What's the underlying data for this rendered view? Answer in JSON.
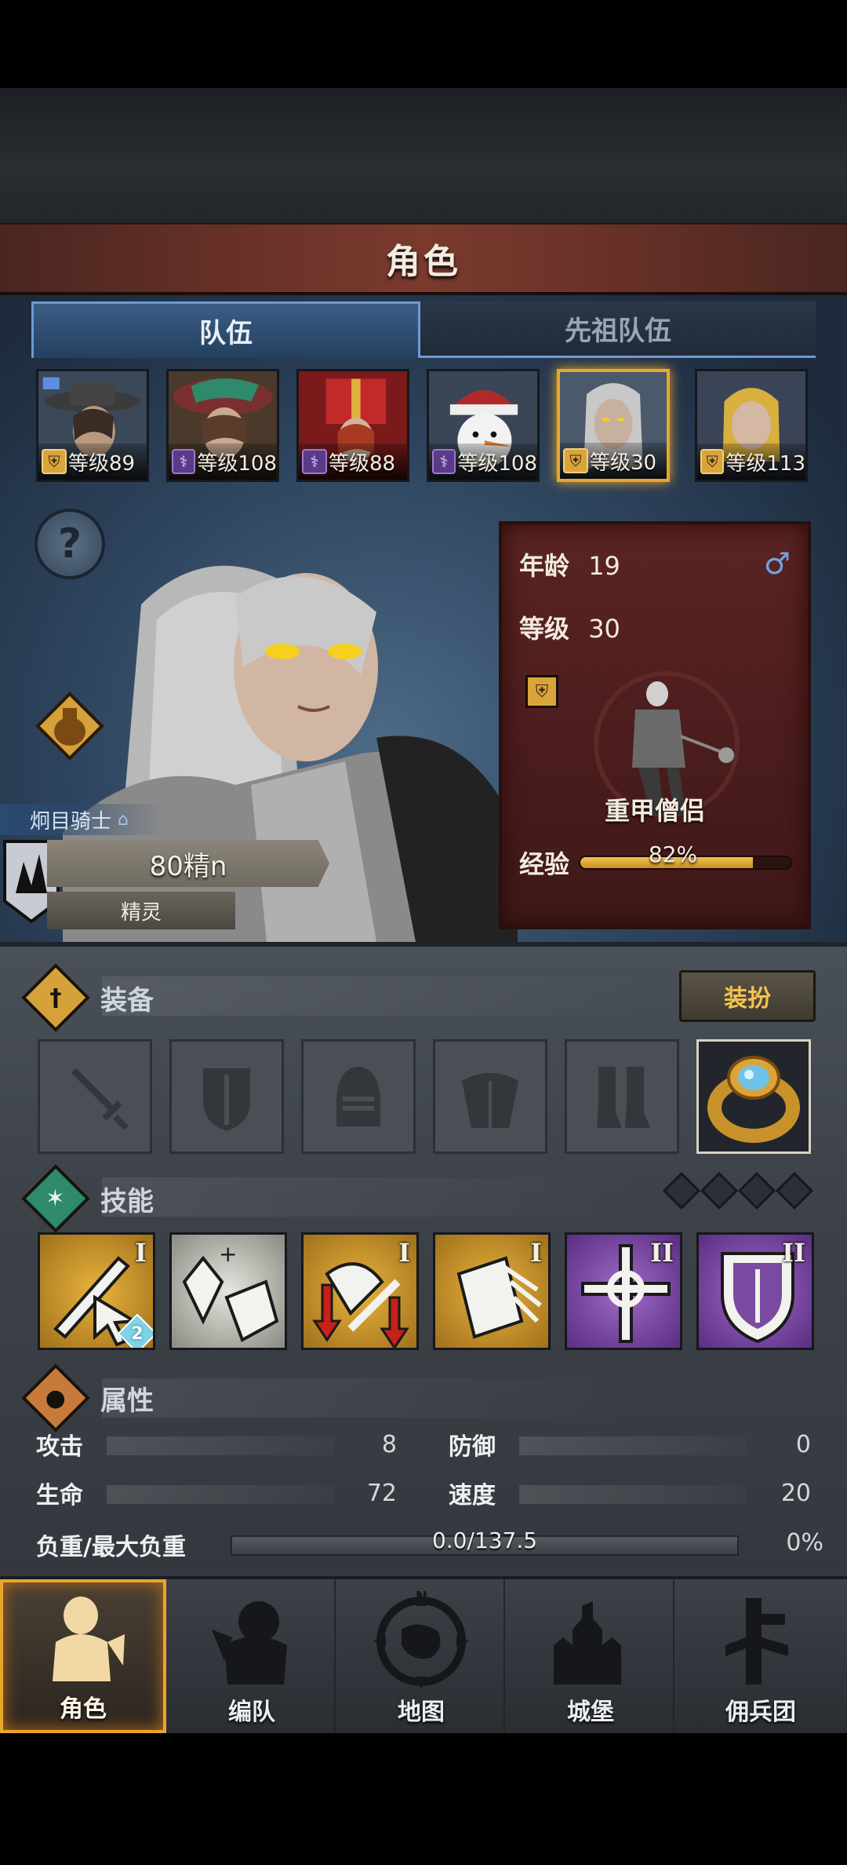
{
  "header": {
    "title": "角色"
  },
  "tabs": [
    {
      "label": "队伍",
      "active": true
    },
    {
      "label": "先祖队伍",
      "active": false
    }
  ],
  "roster": [
    {
      "level_text": "等级89",
      "badge": "shield-badge",
      "badge_color": "#d9a53a",
      "selected": false
    },
    {
      "level_text": "等级108",
      "badge": "staff-badge",
      "badge_color": "#5b3a8a",
      "selected": false
    },
    {
      "level_text": "等级88",
      "badge": "staff-badge",
      "badge_color": "#5b3a8a",
      "selected": false
    },
    {
      "level_text": "等级108",
      "badge": "staff-badge",
      "badge_color": "#5b3a8a",
      "selected": false
    },
    {
      "level_text": "等级30",
      "badge": "shield-badge",
      "badge_color": "#d9a53a",
      "selected": true
    },
    {
      "level_text": "等级113",
      "badge": "shield-badge",
      "badge_color": "#d9a53a",
      "selected": false
    }
  ],
  "hero": {
    "class_name": "炯目骑士",
    "rank_title": "80精n",
    "rank_sub": "精灵"
  },
  "info": {
    "age_label": "年龄",
    "age_value": "19",
    "level_label": "等级",
    "level_value": "30",
    "gender_icon": "male-icon",
    "class_display": "重甲僧侣",
    "exp_label": "经验",
    "exp_text": "82%",
    "exp_fraction": 0.82
  },
  "equipment": {
    "title": "装备",
    "dress_button": "装扮",
    "slots": [
      "sword-icon",
      "shield-icon",
      "helmet-icon",
      "armor-icon",
      "boots-icon",
      "ring-icon"
    ]
  },
  "skills": {
    "title": "技能",
    "items": [
      {
        "icon": "sword-cursor-icon",
        "rank": "I",
        "count": "2",
        "color": "gold"
      },
      {
        "icon": "crystal-shield-icon",
        "rank": "",
        "count": "",
        "color": "silver"
      },
      {
        "icon": "arrows-down-icon",
        "rank": "I",
        "count": "",
        "color": "gold"
      },
      {
        "icon": "shield-bash-icon",
        "rank": "I",
        "count": "",
        "color": "gold"
      },
      {
        "icon": "holy-cross-icon",
        "rank": "II",
        "count": "",
        "color": "purple"
      },
      {
        "icon": "holy-shield-icon",
        "rank": "II",
        "count": "",
        "color": "purple"
      }
    ]
  },
  "attributes": {
    "title": "属性",
    "attack_label": "攻击",
    "attack_value": "8",
    "defense_label": "防御",
    "defense_value": "0",
    "hp_label": "生命",
    "hp_value": "72",
    "speed_label": "速度",
    "speed_value": "20",
    "load_label": "负重/最大负重",
    "load_text": "0.0/137.5",
    "load_pct": "0%"
  },
  "nav": [
    {
      "label": "角色",
      "icon": "knight-icon",
      "active": true
    },
    {
      "label": "编队",
      "icon": "formation-icon",
      "active": false
    },
    {
      "label": "地图",
      "icon": "compass-map-icon",
      "active": false
    },
    {
      "label": "城堡",
      "icon": "castle-icon",
      "active": false
    },
    {
      "label": "佣兵团",
      "icon": "mercenary-icon",
      "active": false
    }
  ],
  "compass_letter": "N"
}
